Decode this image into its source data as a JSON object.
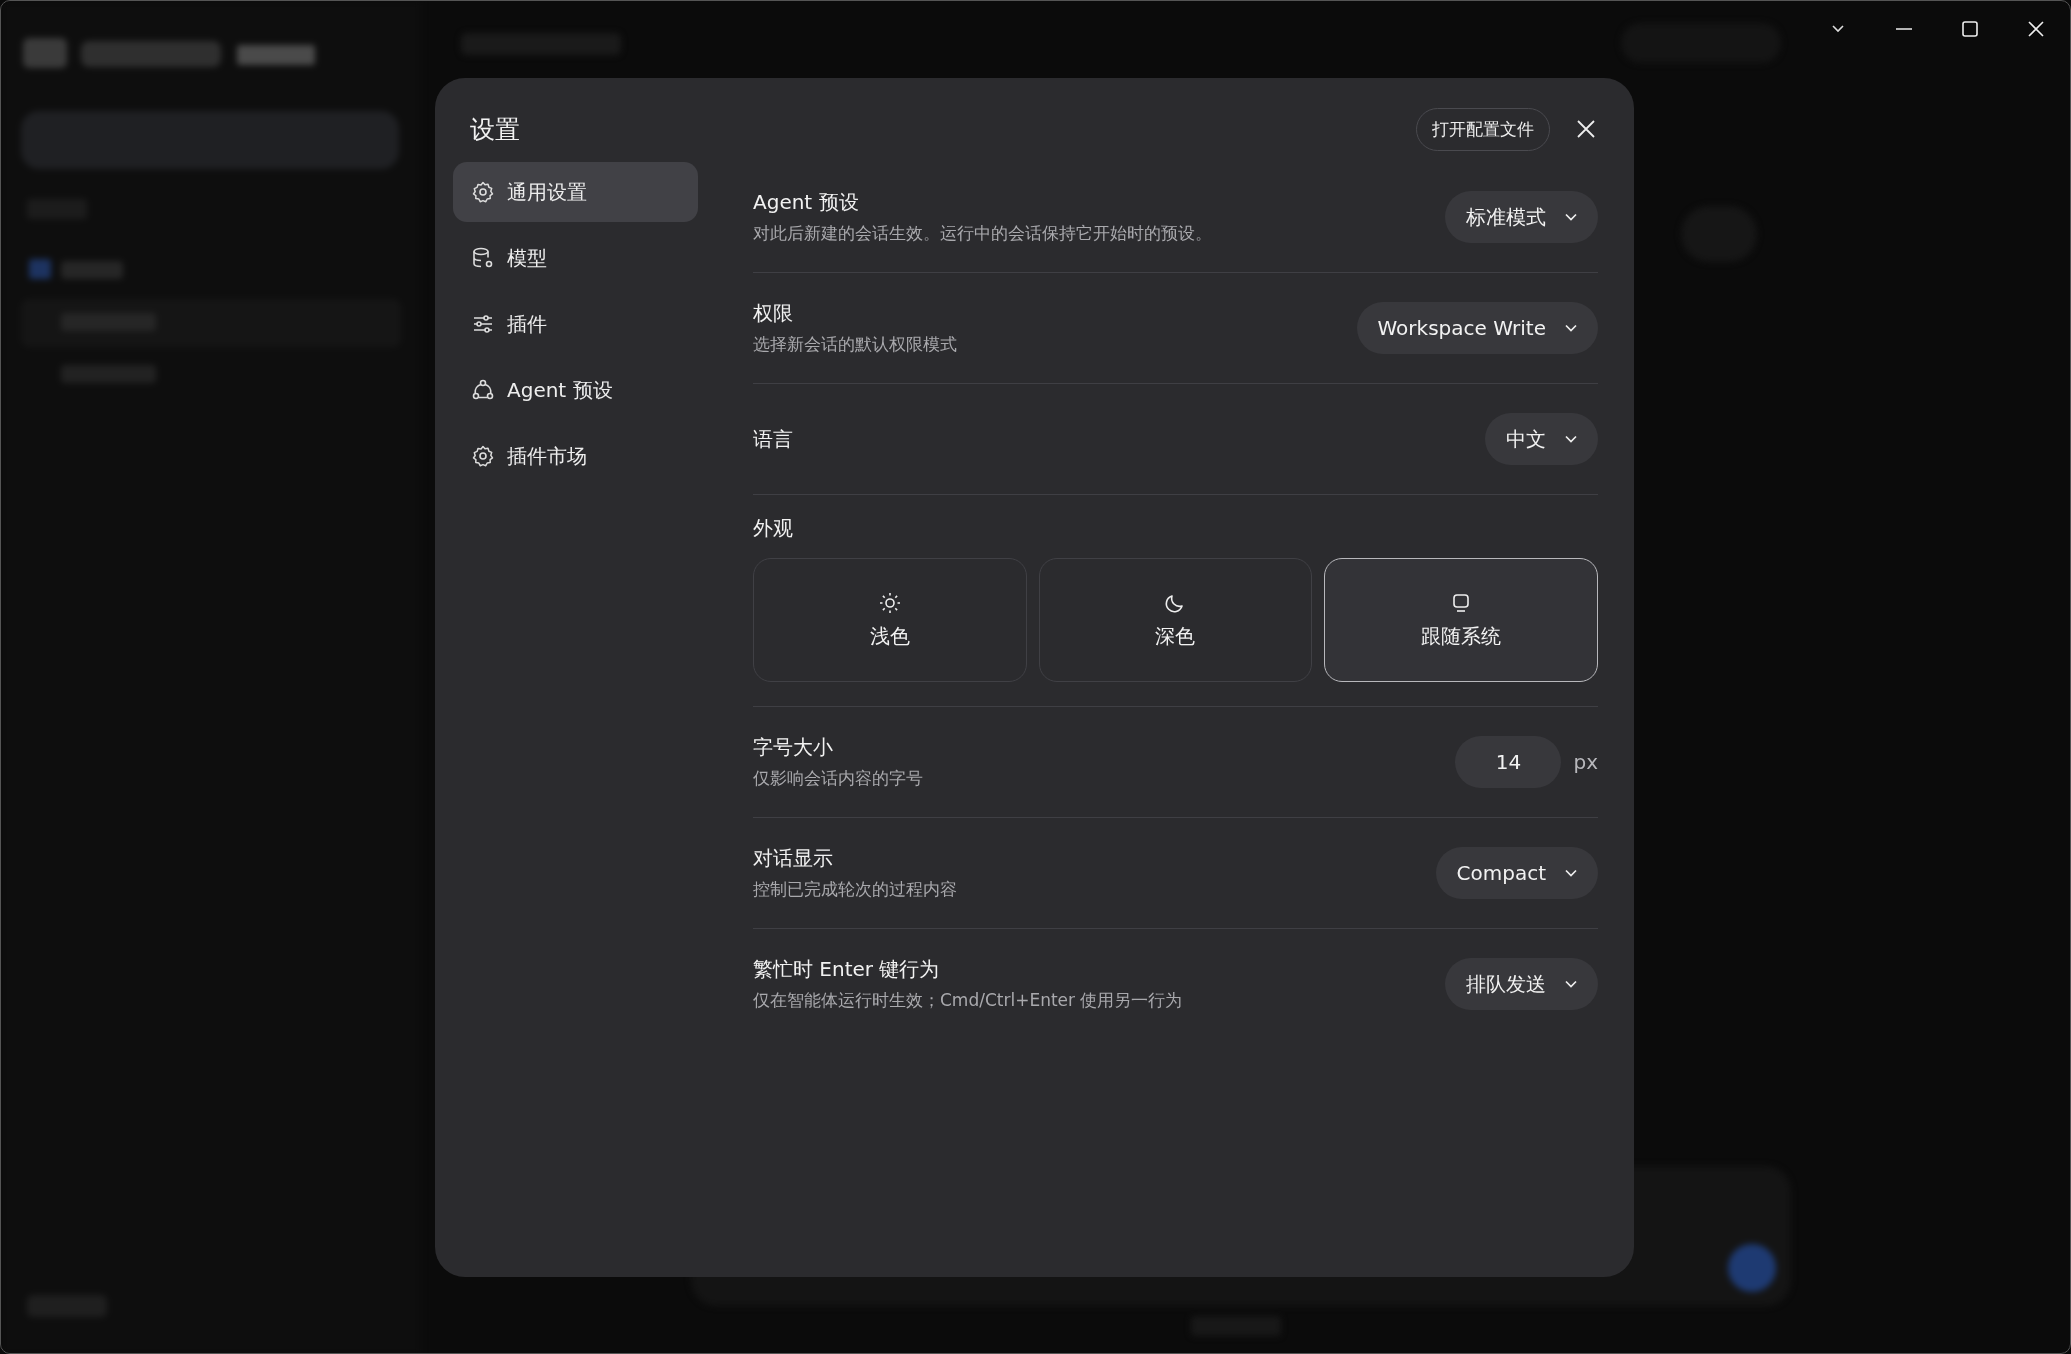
{
  "dialog": {
    "title": "设置",
    "open_config_button": "打开配置文件"
  },
  "nav": [
    {
      "label": "通用设置",
      "selected": true
    },
    {
      "label": "模型",
      "selected": false
    },
    {
      "label": "插件",
      "selected": false
    },
    {
      "label": "Agent 预设",
      "selected": false
    },
    {
      "label": "插件市场",
      "selected": false
    }
  ],
  "settings": [
    {
      "kind": "select",
      "title": "Agent 预设",
      "description": "对此后新建的会话生效。运行中的会话保持它开始时的预设。",
      "value": "标准模式"
    },
    {
      "kind": "select",
      "title": "权限",
      "description": "选择新会话的默认权限模式",
      "value": "Workspace Write"
    },
    {
      "kind": "select",
      "title": "语言",
      "value": "中文"
    },
    {
      "kind": "theme",
      "title": "外观",
      "options": [
        {
          "label": "浅色",
          "selected": false
        },
        {
          "label": "深色",
          "selected": false
        },
        {
          "label": "跟随系统",
          "selected": true
        }
      ]
    },
    {
      "kind": "number",
      "title": "字号大小",
      "description": "仅影响会话内容的字号",
      "value": "14",
      "unit": "px"
    },
    {
      "kind": "select",
      "title": "对话显示",
      "description": "控制已完成轮次的过程内容",
      "value": "Compact"
    },
    {
      "kind": "select",
      "title": "繁忙时 Enter 键行为",
      "description": "仅在智能体运行时生效；Cmd/Ctrl+Enter 使用另一行为",
      "value": "排队发送"
    }
  ]
}
